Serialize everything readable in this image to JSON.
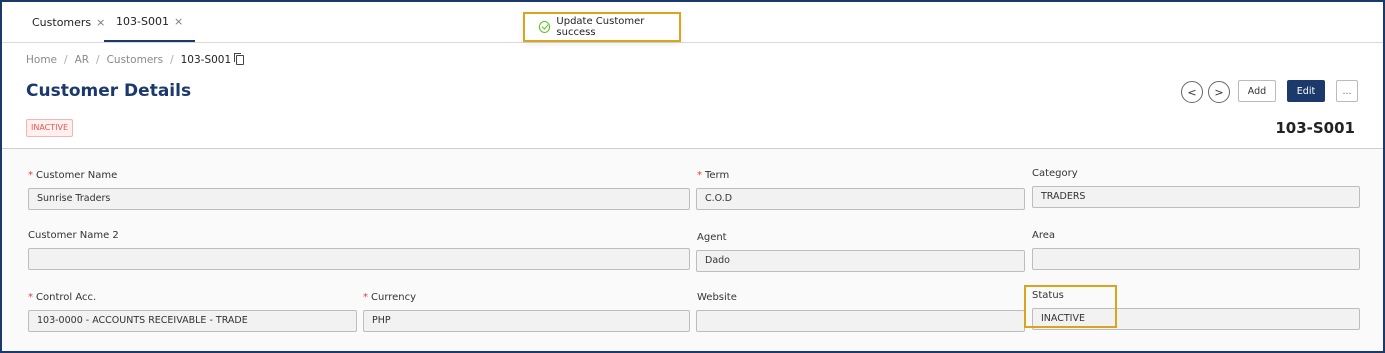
{
  "tabs": [
    {
      "label": "Customers"
    },
    {
      "label": "103-S001"
    }
  ],
  "toast": {
    "message": "Update Customer success"
  },
  "breadcrumb": [
    "Home",
    "AR",
    "Customers",
    "103-S001"
  ],
  "page": {
    "title": "Customer Details",
    "status_tag": "INACTIVE",
    "doc_number": "103-S001"
  },
  "toolbar": {
    "prev_icon": "<",
    "next_icon": ">",
    "add_label": "Add",
    "edit_label": "Edit",
    "more_label": "..."
  },
  "form": {
    "customer_name": {
      "label": "Customer Name",
      "value": "Sunrise Traders",
      "required": true
    },
    "term": {
      "label": "Term",
      "value": "C.O.D",
      "required": true
    },
    "category": {
      "label": "Category",
      "value": "TRADERS"
    },
    "customer_name_2": {
      "label": "Customer Name 2",
      "value": ""
    },
    "agent": {
      "label": "Agent",
      "value": "Dado"
    },
    "area": {
      "label": "Area",
      "value": ""
    },
    "control_acc": {
      "label": "Control Acc.",
      "value": "103-0000 - ACCOUNTS RECEIVABLE - TRADE",
      "required": true
    },
    "currency": {
      "label": "Currency",
      "value": "PHP",
      "required": true
    },
    "website": {
      "label": "Website",
      "value": ""
    },
    "status": {
      "label": "Status",
      "value": "INACTIVE"
    }
  },
  "required_mark": "*",
  "close_glyph": "×",
  "colors": {
    "primary": "#1b3a6b",
    "highlight": "#d9a520",
    "success": "#52c41a",
    "required": "#e04040"
  }
}
